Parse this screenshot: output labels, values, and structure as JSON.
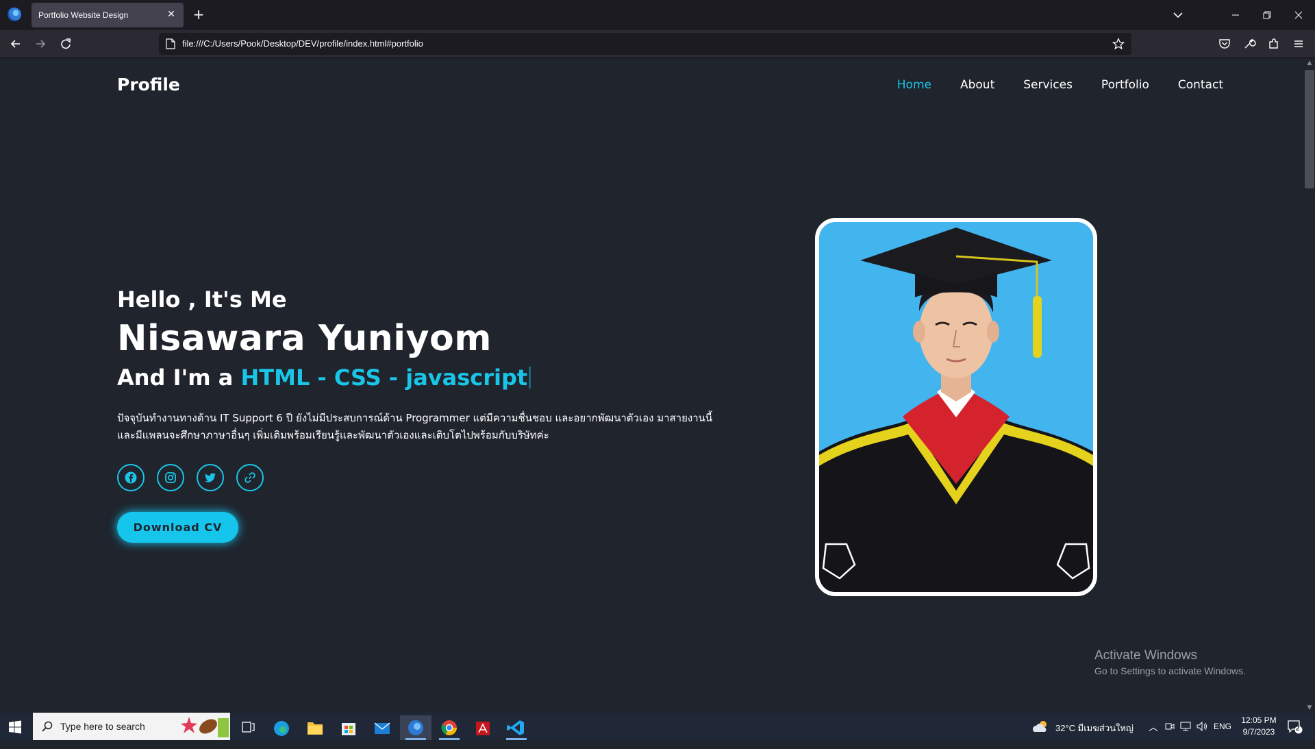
{
  "browser": {
    "tab_title": "Portfolio Website Design",
    "url": "file:///C:/Users/Pook/Desktop/DEV/profile/index.html#portfolio"
  },
  "header": {
    "logo": "Profile",
    "nav": [
      {
        "label": "Home",
        "active": true
      },
      {
        "label": "About",
        "active": false
      },
      {
        "label": "Services",
        "active": false
      },
      {
        "label": "Portfolio",
        "active": false
      },
      {
        "label": "Contact",
        "active": false
      }
    ]
  },
  "hero": {
    "greeting": "Hello , It's Me",
    "name": "Nisawara Yuniyom",
    "role_prefix": "And I'm a ",
    "role_highlight": "HTML - CSS - javascript",
    "description_line1": "ปัจจุบันทำงานทางด้าน IT Support 6 ปี ยังไม่มีประสบการณ์ด้าน Programmer แต่มีความชื่นชอบ และอยากพัฒนาตัวเอง มาสายงานนี้",
    "description_line2": "และมีแพลนจะศึกษาภาษาอื่นๆ เพิ่มเติมพร้อมเรียนรู้และพัฒนาตัวเองและเติบโตไปพร้อมกับบริษัทค่ะ",
    "socials": [
      "facebook-icon",
      "instagram-icon",
      "twitter-icon",
      "link-icon"
    ],
    "cta": "Download CV"
  },
  "watermark": {
    "title": "Activate Windows",
    "subtitle": "Go to Settings to activate Windows."
  },
  "taskbar": {
    "search_placeholder": "Type here to search",
    "weather": "32°C  มีเมฆส่วนใหญ่",
    "lang": "ENG",
    "time": "12:05 PM",
    "date": "9/7/2023",
    "notifications": "2"
  },
  "colors": {
    "accent": "#16c5ec",
    "background": "#1f242d"
  }
}
